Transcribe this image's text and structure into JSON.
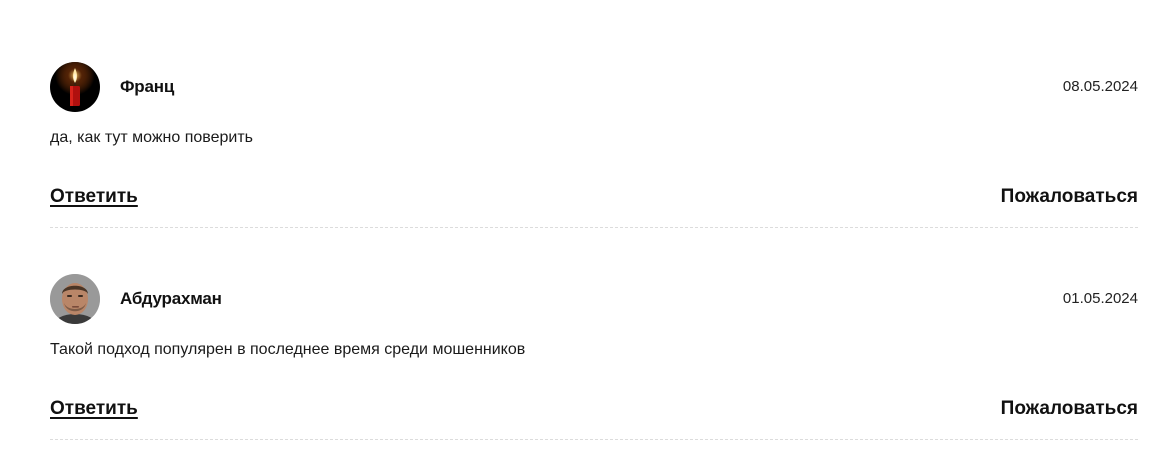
{
  "comments": [
    {
      "author": "Франц",
      "date": "08.05.2024",
      "text": "да, как тут можно поверить",
      "reply_label": "Ответить",
      "report_label": "Пожаловаться",
      "avatar_icon": "candle-icon"
    },
    {
      "author": "Абдурахман",
      "date": "01.05.2024",
      "text": "Такой подход популярен в последнее время среди мошенников",
      "reply_label": "Ответить",
      "report_label": "Пожаловаться",
      "avatar_icon": "user-photo-icon"
    }
  ]
}
